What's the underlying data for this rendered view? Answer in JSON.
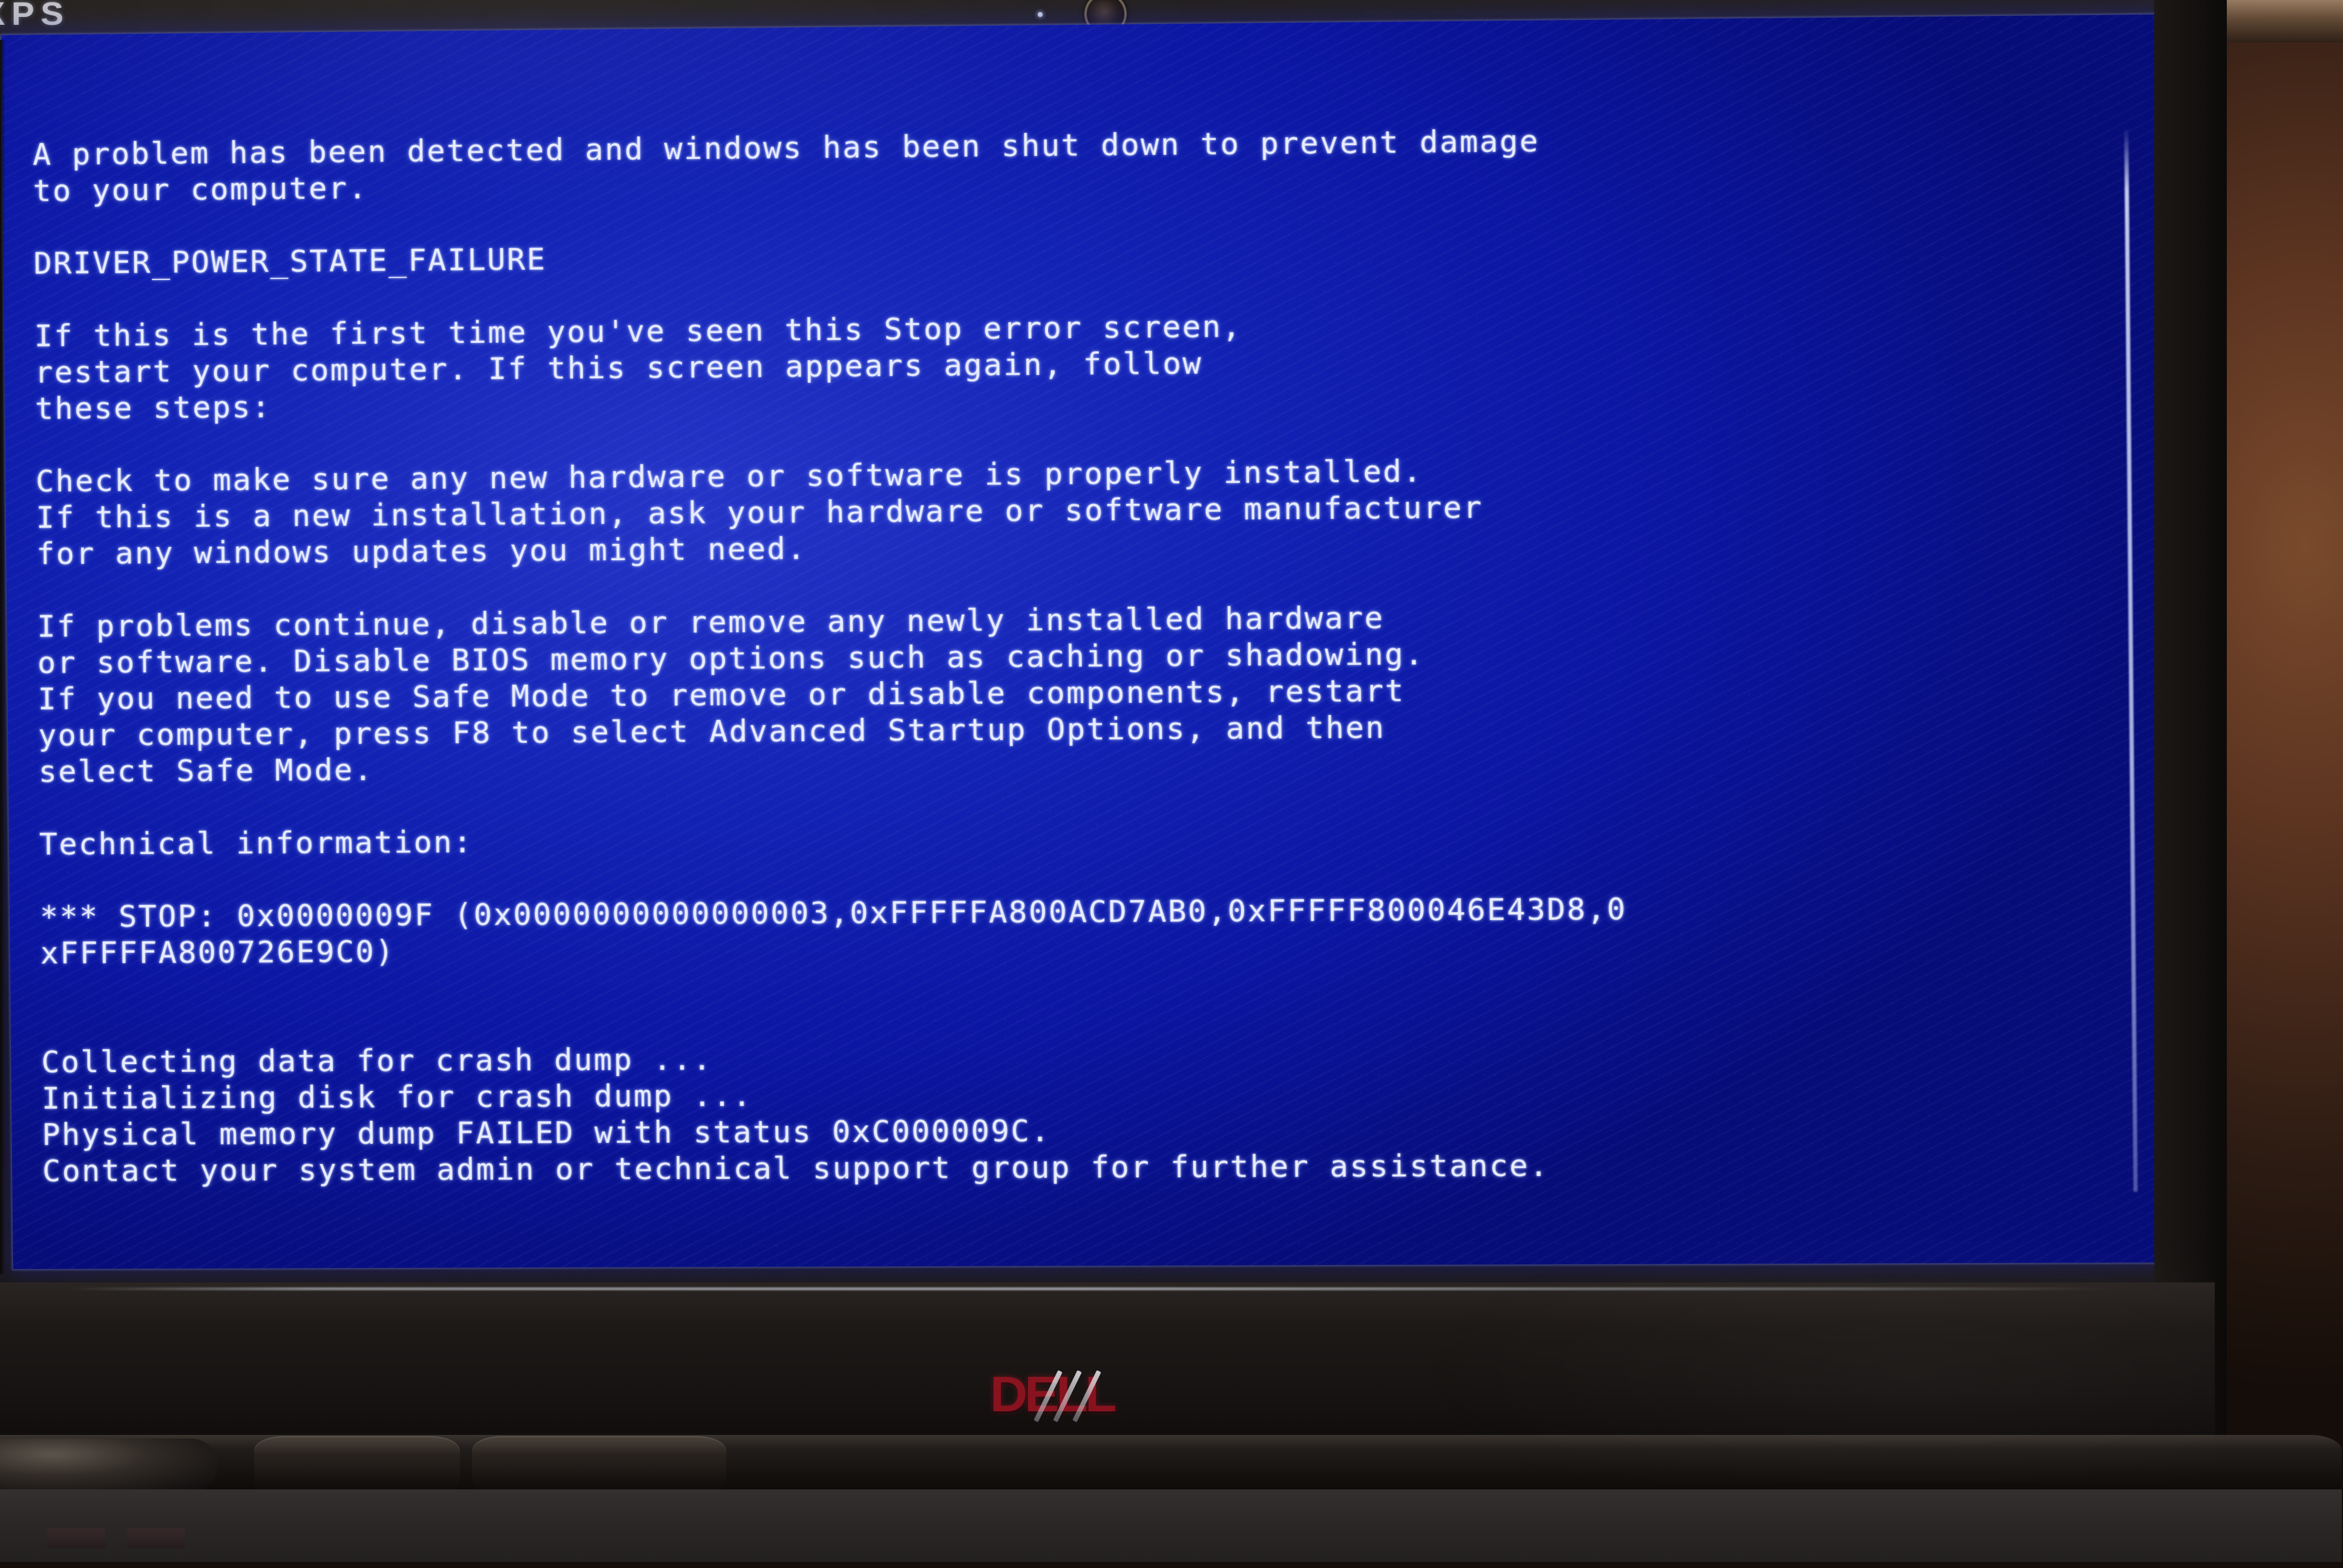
{
  "device": {
    "brand_badge": "XPS",
    "vendor_logo": "DELL",
    "screen_color": "#0f1cb4",
    "text_color": "#e9edff",
    "logo_color": "#8f1420"
  },
  "bsod": {
    "intro": [
      "A problem has been detected and windows has been shut down to prevent damage",
      "to your computer."
    ],
    "stop_code_name": "DRIVER_POWER_STATE_FAILURE",
    "first_time": [
      "If this is the first time you've seen this Stop error screen,",
      "restart your computer. If this screen appears again, follow",
      "these steps:"
    ],
    "check_hardware": [
      "Check to make sure any new hardware or software is properly installed.",
      "If this is a new installation, ask your hardware or software manufacturer",
      "for any windows updates you might need."
    ],
    "if_problems": [
      "If problems continue, disable or remove any newly installed hardware",
      "or software. Disable BIOS memory options such as caching or shadowing.",
      "If you need to use Safe Mode to remove or disable components, restart",
      "your computer, press F8 to select Advanced Startup Options, and then",
      "select Safe Mode."
    ],
    "technical_heading": "Technical information:",
    "stop_line": [
      "*** STOP: 0x0000009F (0x0000000000000003,0xFFFFFA800ACD7AB0,0xFFFFF800046E43D8,0",
      "xFFFFFA800726E9C0)"
    ],
    "dump_status": [
      "Collecting data for crash dump ...",
      "Initializing disk for crash dump ...",
      "Physical memory dump FAILED with status 0xC000009C.",
      "Contact your system admin or technical support group for further assistance."
    ],
    "stop_code_hex": "0x0000009F",
    "dump_status_hex": "0xC000009C",
    "parameters": [
      "0x0000000000000003",
      "0xFFFFFA800ACD7AB0",
      "0xFFFFF800046E43D8",
      "0xFFFFFA800726E9C0"
    ]
  }
}
